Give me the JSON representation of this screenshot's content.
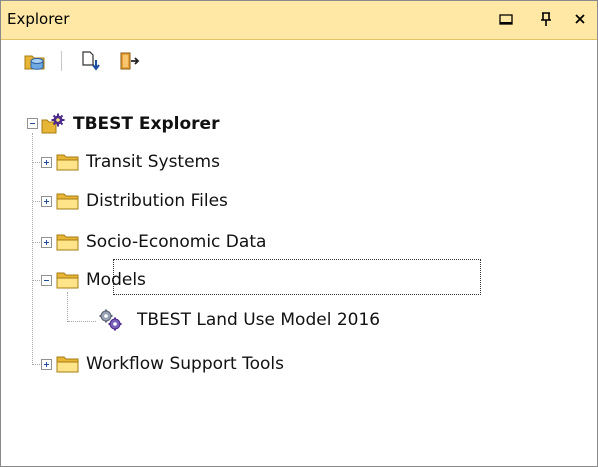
{
  "window": {
    "title": "Explorer",
    "buttons": [
      {
        "name": "maximize-icon",
        "glyph": "□"
      },
      {
        "name": "pin-icon",
        "glyph": "ᵖ"
      },
      {
        "name": "close-icon",
        "glyph": "✕"
      }
    ]
  },
  "toolbar": {
    "items": [
      {
        "name": "open-database-icon"
      },
      {
        "name": "import-icon"
      },
      {
        "name": "exit-icon"
      }
    ]
  },
  "tree": {
    "root": {
      "label": "TBEST Explorer",
      "expanded": true
    },
    "items": [
      {
        "label": "Transit Systems",
        "expanded": false
      },
      {
        "label": "Distribution Files",
        "expanded": false
      },
      {
        "label": "Socio-Economic Data",
        "expanded": false
      },
      {
        "label": "Models",
        "expanded": true,
        "focused": true,
        "children": [
          {
            "label": "TBEST Land Use Model 2016"
          }
        ]
      },
      {
        "label": "Workflow Support Tools",
        "expanded": false
      }
    ]
  },
  "colors": {
    "titlebar": "#ffe8a6",
    "folder": "#e8b636",
    "folder_light": "#ffe48a"
  }
}
